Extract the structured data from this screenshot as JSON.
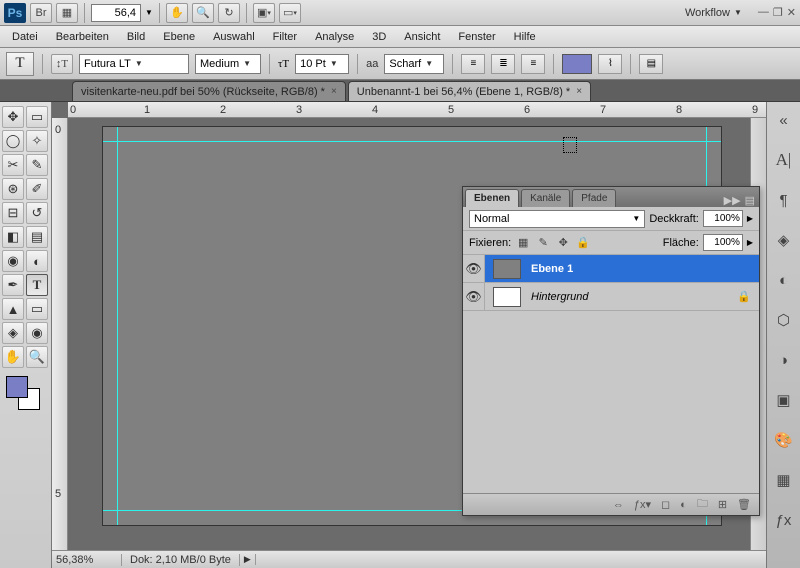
{
  "topbar": {
    "zoom": "56,4",
    "workflow_label": "Workflow"
  },
  "menu": [
    "Datei",
    "Bearbeiten",
    "Bild",
    "Ebene",
    "Auswahl",
    "Filter",
    "Analyse",
    "3D",
    "Ansicht",
    "Fenster",
    "Hilfe"
  ],
  "options": {
    "font_family": "Futura LT",
    "font_style": "Medium",
    "font_size": "10 Pt",
    "aa_label": "aa",
    "aa_value": "Scharf"
  },
  "tabs": [
    {
      "label": "visitenkarte-neu.pdf bei 50% (Rückseite, RGB/8) *",
      "active": false
    },
    {
      "label": "Unbenannt-1 bei 56,4% (Ebene 1, RGB/8) *",
      "active": true
    }
  ],
  "ruler_h": [
    "0",
    "1",
    "2",
    "3",
    "4",
    "5",
    "6",
    "7",
    "8",
    "9"
  ],
  "ruler_v": [
    "0",
    "5"
  ],
  "status": {
    "zoom": "56,38%",
    "doc": "Dok: 2,10 MB/0 Byte"
  },
  "layers_panel": {
    "tabs": [
      "Ebenen",
      "Kanäle",
      "Pfade"
    ],
    "blend_mode": "Normal",
    "opacity_label": "Deckkraft:",
    "opacity_value": "100%",
    "lock_label": "Fixieren:",
    "fill_label": "Fläche:",
    "fill_value": "100%",
    "layers": [
      {
        "name": "Ebene 1",
        "selected": true,
        "locked": false,
        "bg": false
      },
      {
        "name": "Hintergrund",
        "selected": false,
        "locked": true,
        "bg": true
      }
    ]
  }
}
